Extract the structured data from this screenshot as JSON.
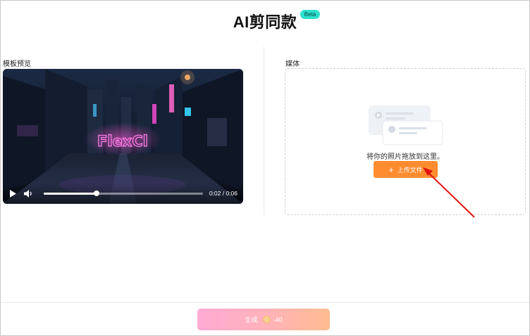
{
  "header": {
    "title": "AI剪同款",
    "badge": "Beta"
  },
  "preview": {
    "label": "模板预览",
    "video": {
      "overlay_text": "FlexCl",
      "time": "0:02 / 0:06",
      "progress": 0.33
    }
  },
  "media": {
    "label": "媒体",
    "drop_text": "将你的照片拖放到这里。",
    "upload_label": "上传文件"
  },
  "footer": {
    "generate_label": "生成",
    "cost": "-40"
  },
  "colors": {
    "accent_orange": "#ff8c2f",
    "beta_badge": "#2ee0cf",
    "arrow_red": "#e01010"
  }
}
